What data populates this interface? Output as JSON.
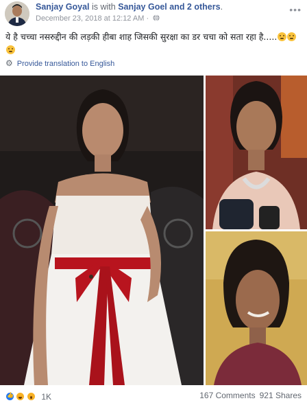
{
  "post": {
    "author": "Sanjay Goyal",
    "with_text": " is with ",
    "tagged": "Sanjay Goel and 2 others",
    "period": ".",
    "date": "December 23, 2018 at 12:12 AM",
    "separator": " · ",
    "privacy_icon": "globe-icon",
    "more_icon": "more-options-icon",
    "text": "ये है चच्चा नसरुद्दीन की लड़की हीबा शाह जिसकी सुरक्षा का डर चचा को सता रहा है.....",
    "text_emoji_count": 3,
    "translate_label": "Provide translation to English"
  },
  "photos": {
    "count": 3
  },
  "footer": {
    "reactions": [
      "like",
      "haha",
      "wow"
    ],
    "reaction_count": "1K",
    "comments": "167 Comments",
    "shares": "921 Shares"
  },
  "colors": {
    "link": "#365899",
    "meta": "#90949c",
    "text": "#1c1e21",
    "like": "#2078f4",
    "emoji": "#f7b125"
  }
}
